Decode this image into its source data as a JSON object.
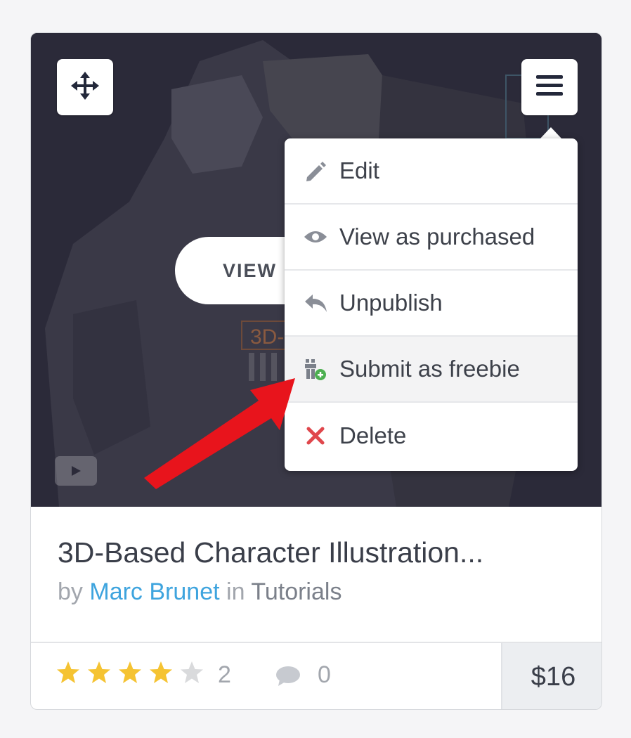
{
  "thumbnail": {
    "view_button_label": "VIEW",
    "overlay_text": "3D-"
  },
  "dropdown": {
    "items": [
      {
        "label": "Edit",
        "icon": "pencil-icon"
      },
      {
        "label": "View as purchased",
        "icon": "eye-icon"
      },
      {
        "label": "Unpublish",
        "icon": "reply-arrow-icon"
      },
      {
        "label": "Submit as freebie",
        "icon": "gift-plus-icon"
      },
      {
        "label": "Delete",
        "icon": "close-x-icon"
      }
    ]
  },
  "product": {
    "title": "3D-Based Character Illustration...",
    "by_label": "by",
    "author": "Marc Brunet",
    "in_label": "in",
    "category": "Tutorials"
  },
  "footer": {
    "rating": 4,
    "rating_max": 5,
    "rating_count": "2",
    "comment_count": "0",
    "price": "$16"
  },
  "colors": {
    "star": "#f5c332",
    "star_empty": "#d9dadc",
    "link": "#3ea4de",
    "delete": "#e0474c",
    "arrow": "#e8141c"
  }
}
